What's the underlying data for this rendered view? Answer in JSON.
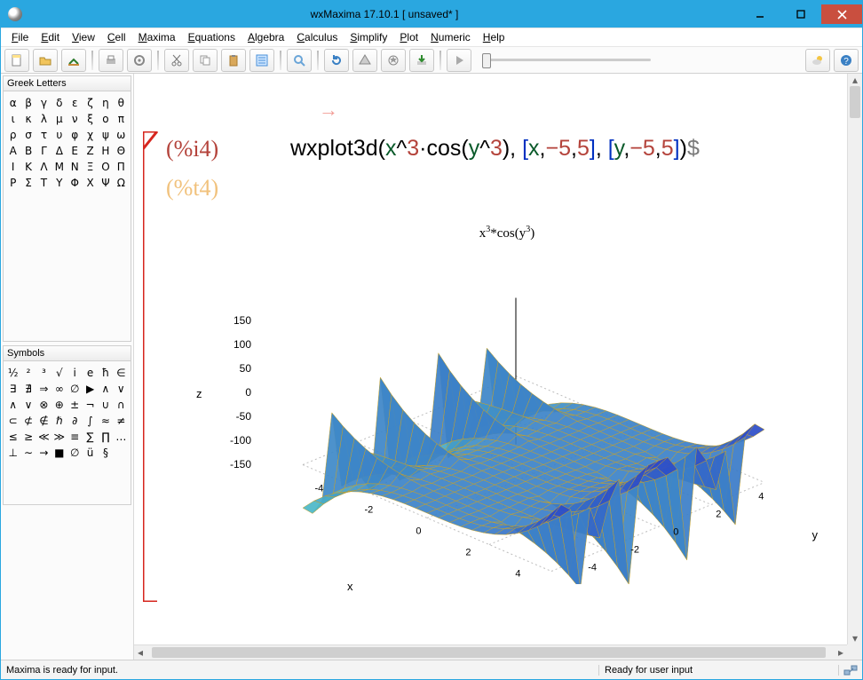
{
  "window": {
    "title": "wxMaxima 17.10.1 [ unsaved* ]"
  },
  "menu": [
    "File",
    "Edit",
    "View",
    "Cell",
    "Maxima",
    "Equations",
    "Algebra",
    "Calculus",
    "Simplify",
    "Plot",
    "Numeric",
    "Help"
  ],
  "panels": {
    "greek": {
      "title": "Greek Letters",
      "rows": [
        [
          "α",
          "β",
          "γ",
          "δ",
          "ε",
          "ζ",
          "η",
          "θ"
        ],
        [
          "ι",
          "κ",
          "λ",
          "μ",
          "ν",
          "ξ",
          "ο",
          "π"
        ],
        [
          "ρ",
          "σ",
          "τ",
          "υ",
          "φ",
          "χ",
          "ψ",
          "ω"
        ],
        [
          "Α",
          "Β",
          "Γ",
          "Δ",
          "Ε",
          "Ζ",
          "Η",
          "Θ"
        ],
        [
          "Ι",
          "Κ",
          "Λ",
          "Μ",
          "Ν",
          "Ξ",
          "Ο",
          "Π"
        ],
        [
          "Ρ",
          "Σ",
          "Τ",
          "Υ",
          "Φ",
          "Χ",
          "Ψ",
          "Ω"
        ]
      ]
    },
    "symbols": {
      "title": "Symbols",
      "rows": [
        [
          "½",
          "²",
          "³",
          "√",
          "і",
          "е",
          "ħ",
          "∈"
        ],
        [
          "∃",
          "∄",
          "⇒",
          "∞",
          "∅",
          "▶",
          "∧"
        ],
        [
          "∨",
          "∧",
          "∨",
          "⊗",
          "⊕",
          "±",
          "¬",
          "∪"
        ],
        [
          "∩",
          "⊂",
          "⊄",
          "∉",
          "ℏ",
          "∂"
        ],
        [
          "∫",
          "≈",
          "≠",
          "≤",
          "≥",
          "≪",
          "≫"
        ],
        [
          "≡",
          "∑",
          "∏",
          "…",
          "⊥",
          "∼",
          "→"
        ],
        [
          "■"
        ],
        [
          "∅",
          "ü",
          "§"
        ]
      ]
    }
  },
  "cell": {
    "input_label": "(%i4)",
    "output_label": "(%t4)",
    "code_plain": "wxplot3d(x^3·cos(y^3), [x,−5,5], [y,−5,5])$"
  },
  "plot": {
    "title_html": "x<sup>3</sup>*cos(y<sup>3</sup>)",
    "z_ticks": [
      "150",
      "100",
      "50",
      "0",
      "-50",
      "-100",
      "-150"
    ],
    "z_label": "z",
    "x_label": "x",
    "y_label": "y",
    "x_ticks": [
      "-4",
      "-2",
      "0",
      "2",
      "4"
    ],
    "y_ticks": [
      "-4",
      "-2",
      "0",
      "2",
      "4"
    ]
  },
  "status": {
    "left": "Maxima is ready for input.",
    "right": "Ready for user input"
  },
  "chart_data": {
    "type": "surface3d",
    "title": "x^3*cos(y^3)",
    "expression": "x^3*cos(y^3)",
    "x": {
      "label": "x",
      "range": [
        -5,
        5
      ],
      "ticks": [
        -4,
        -2,
        0,
        2,
        4
      ]
    },
    "y": {
      "label": "y",
      "range": [
        -5,
        5
      ],
      "ticks": [
        -4,
        -2,
        0,
        2,
        4
      ]
    },
    "z": {
      "label": "z",
      "range": [
        -150,
        150
      ],
      "ticks": [
        -150,
        -100,
        -50,
        0,
        50,
        100,
        150
      ]
    }
  },
  "colors": {
    "accent": "#2aa7e0",
    "prompt": "#b4433b",
    "output_label": "#f1c27d",
    "var": "#0a5a2a",
    "bracket_blue": "#0030c0",
    "cell_bracket": "#d6261e"
  }
}
